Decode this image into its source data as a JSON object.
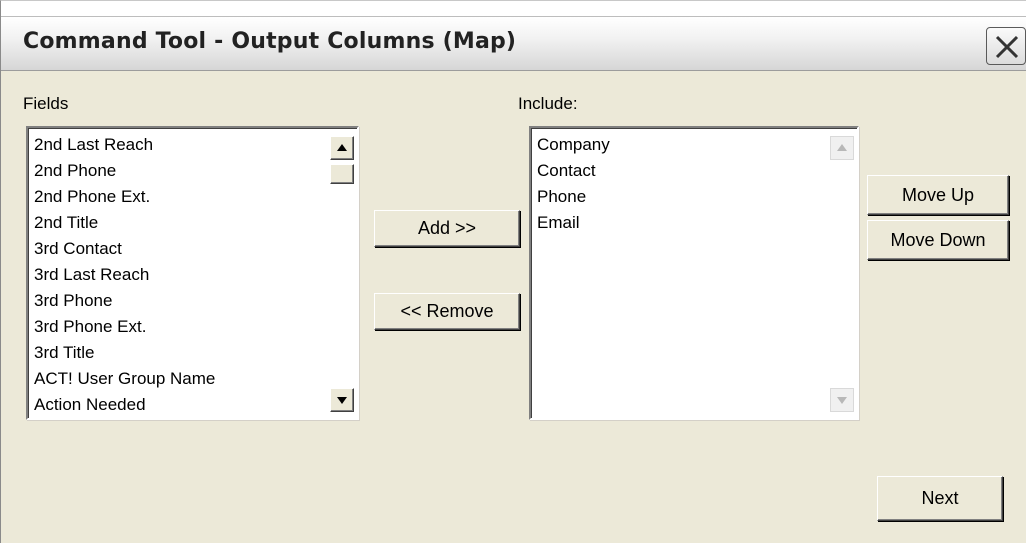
{
  "window": {
    "title": "Command Tool - Output Columns (Map)",
    "close_icon": "close-icon"
  },
  "fields": {
    "label": "Fields",
    "items": [
      "2nd Last Reach",
      "2nd Phone",
      "2nd Phone Ext.",
      "2nd Title",
      "3rd Contact",
      "3rd Last Reach",
      "3rd Phone",
      "3rd Phone Ext.",
      "3rd Title",
      "ACT! User Group Name",
      "Action Needed"
    ]
  },
  "include": {
    "label": "Include:",
    "items": [
      "Company",
      "Contact",
      "Phone",
      "Email"
    ]
  },
  "buttons": {
    "add": "Add >>",
    "remove": "<< Remove",
    "move_up": "Move Up",
    "move_down": "Move Down",
    "next": "Next"
  },
  "colors": {
    "dialog_background": "#ece9d8",
    "list_background": "#ffffff"
  }
}
